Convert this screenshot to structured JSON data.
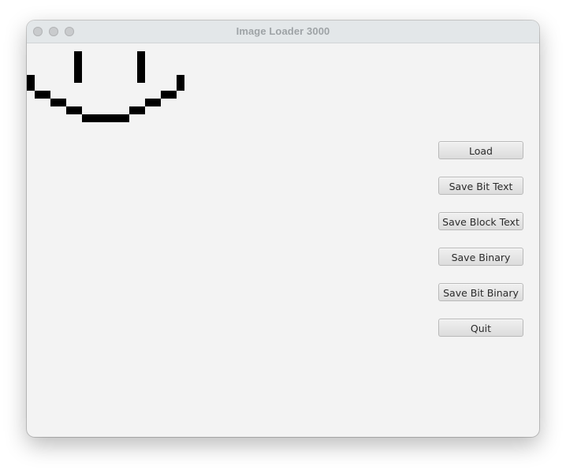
{
  "window": {
    "title": "Image Loader 3000"
  },
  "buttons": {
    "load": "Load",
    "save_bit_text": "Save Bit Text",
    "save_block_text": "Save Block Text",
    "save_binary": "Save Binary",
    "save_bit_binary": "Save Bit Binary",
    "quit": "Quit"
  },
  "colors": {
    "pixel_on": "#000000",
    "window_background": "#f3f3f3",
    "titlebar": "#e3e7e9",
    "title_text": "#9ea3a6"
  }
}
